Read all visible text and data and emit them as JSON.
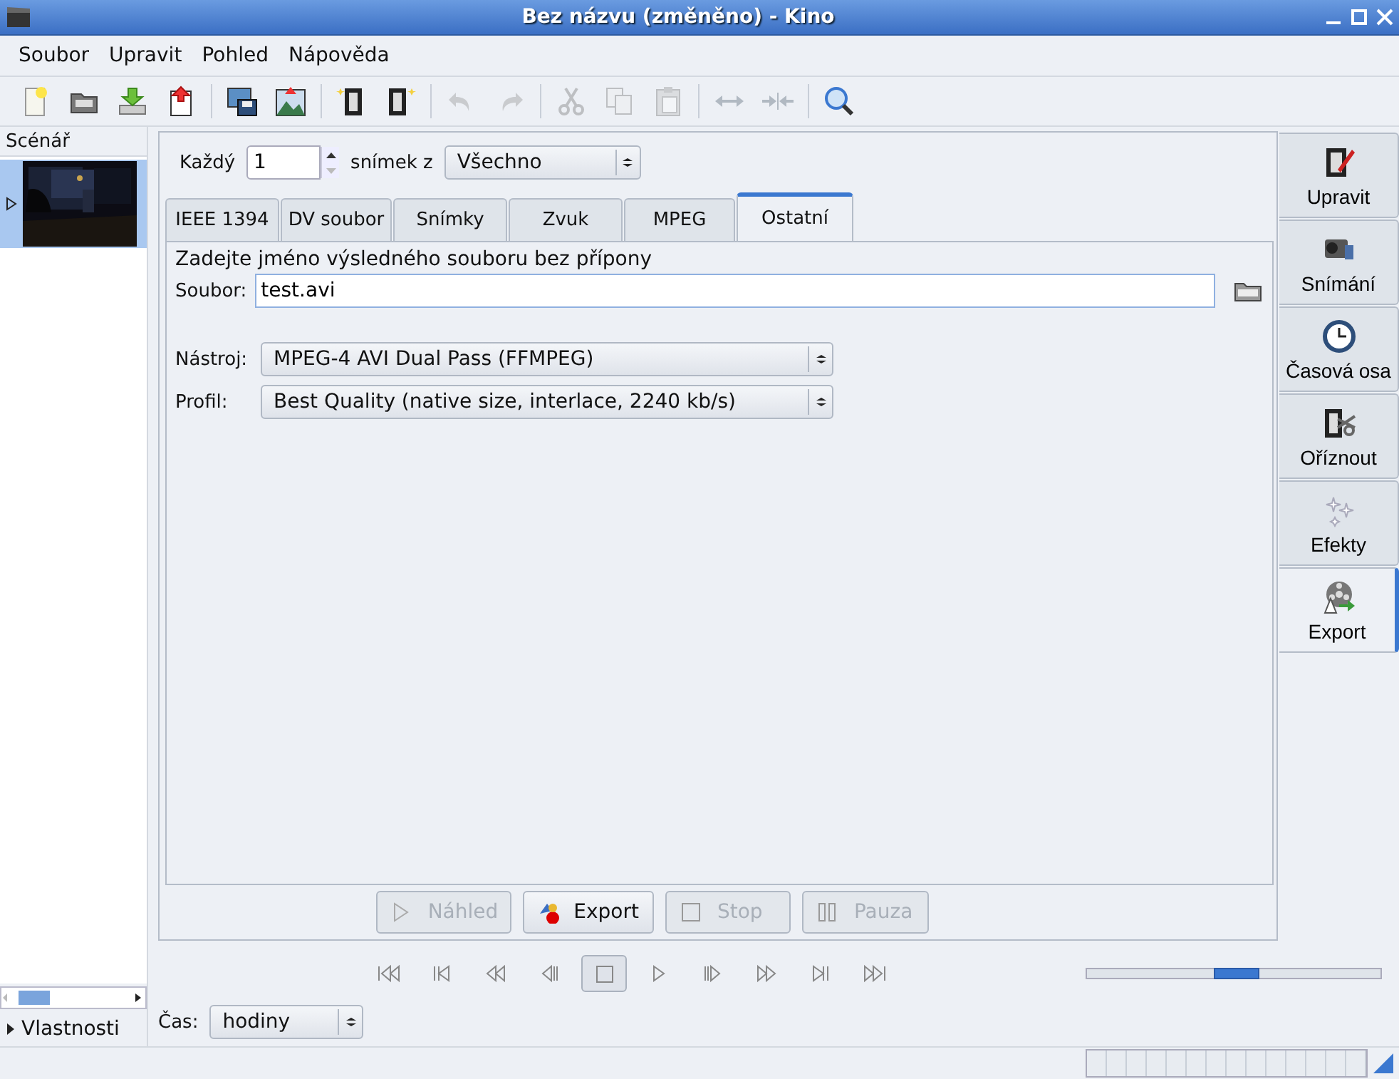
{
  "window": {
    "title": "Bez názvu (změněno)  - Kino"
  },
  "menu": [
    "Soubor",
    "Upravit",
    "Pohled",
    "Nápověda"
  ],
  "toolbar": [
    {
      "kind": "new",
      "disabled": false
    },
    {
      "kind": "open",
      "disabled": false
    },
    {
      "kind": "save",
      "disabled": false
    },
    {
      "kind": "upload",
      "disabled": false
    },
    {
      "kind": "sep"
    },
    {
      "kind": "savepic",
      "disabled": false
    },
    {
      "kind": "landscape",
      "disabled": false
    },
    {
      "kind": "sep"
    },
    {
      "kind": "filmstart",
      "disabled": false
    },
    {
      "kind": "filmend",
      "disabled": false
    },
    {
      "kind": "sep"
    },
    {
      "kind": "undo",
      "disabled": true
    },
    {
      "kind": "redo",
      "disabled": true
    },
    {
      "kind": "sep"
    },
    {
      "kind": "cut",
      "disabled": true
    },
    {
      "kind": "copy",
      "disabled": true
    },
    {
      "kind": "paste",
      "disabled": true
    },
    {
      "kind": "sep"
    },
    {
      "kind": "split",
      "disabled": true
    },
    {
      "kind": "join",
      "disabled": true
    },
    {
      "kind": "sep"
    },
    {
      "kind": "zoom",
      "disabled": false
    }
  ],
  "sidebar": {
    "title": "Scénář",
    "scenes": [
      {
        "selected": true,
        "expanded": false
      }
    ],
    "properties": {
      "label": "Vlastnosti",
      "expanded": false
    }
  },
  "frame_selector": {
    "label": "Každý",
    "value": "1",
    "between": "snímek z",
    "choice": "Všechno"
  },
  "tabs": [
    {
      "label": "IEEE 1394",
      "selected": false
    },
    {
      "label": "DV soubor",
      "selected": false
    },
    {
      "label": "Snímky",
      "selected": false
    },
    {
      "label": "Zvuk",
      "selected": false
    },
    {
      "label": "MPEG",
      "selected": false
    },
    {
      "label": "Ostatní",
      "selected": true
    }
  ],
  "export_form": {
    "hint": "Zadejte jméno výsledného souboru bez přípony",
    "file_label": "Soubor:",
    "file_value": "test.avi",
    "selects": [
      {
        "label": "Nástroj:",
        "value": "MPEG-4 AVI Dual Pass (FFMPEG)"
      },
      {
        "label": "Profil:",
        "value": "Best Quality (native size, interlace, 2240 kb/s)"
      }
    ]
  },
  "actions": [
    {
      "label": "Náhled",
      "kind": "play",
      "disabled": true
    },
    {
      "label": "Export",
      "kind": "export",
      "disabled": false
    },
    {
      "label": "Stop",
      "kind": "stop",
      "disabled": true
    },
    {
      "label": "Pauza",
      "kind": "pause",
      "disabled": true
    }
  ],
  "transport": [
    {
      "kind": "first",
      "selected": false
    },
    {
      "kind": "prevscene",
      "selected": false
    },
    {
      "kind": "rewind",
      "selected": false
    },
    {
      "kind": "prevframe",
      "selected": false
    },
    {
      "kind": "stop",
      "selected": true
    },
    {
      "kind": "play",
      "selected": false
    },
    {
      "kind": "nextframe",
      "selected": false
    },
    {
      "kind": "forward",
      "selected": false
    },
    {
      "kind": "nextscene",
      "selected": false
    },
    {
      "kind": "last",
      "selected": false
    }
  ],
  "shuttle": {
    "level": 0.5
  },
  "time": {
    "label": "Čas:",
    "value": "hodiny"
  },
  "status_bar": {
    "level": 0
  },
  "modes": [
    {
      "label": "Upravit",
      "kind": "edit",
      "selected": false
    },
    {
      "label": "Snímání",
      "kind": "camera",
      "selected": false
    },
    {
      "label": "Časová osa",
      "kind": "clock",
      "selected": false
    },
    {
      "label": "Oříznout",
      "kind": "trim",
      "selected": false
    },
    {
      "label": "Efekty",
      "kind": "sparkle",
      "selected": false
    },
    {
      "label": "Export",
      "kind": "reel",
      "selected": true
    }
  ]
}
